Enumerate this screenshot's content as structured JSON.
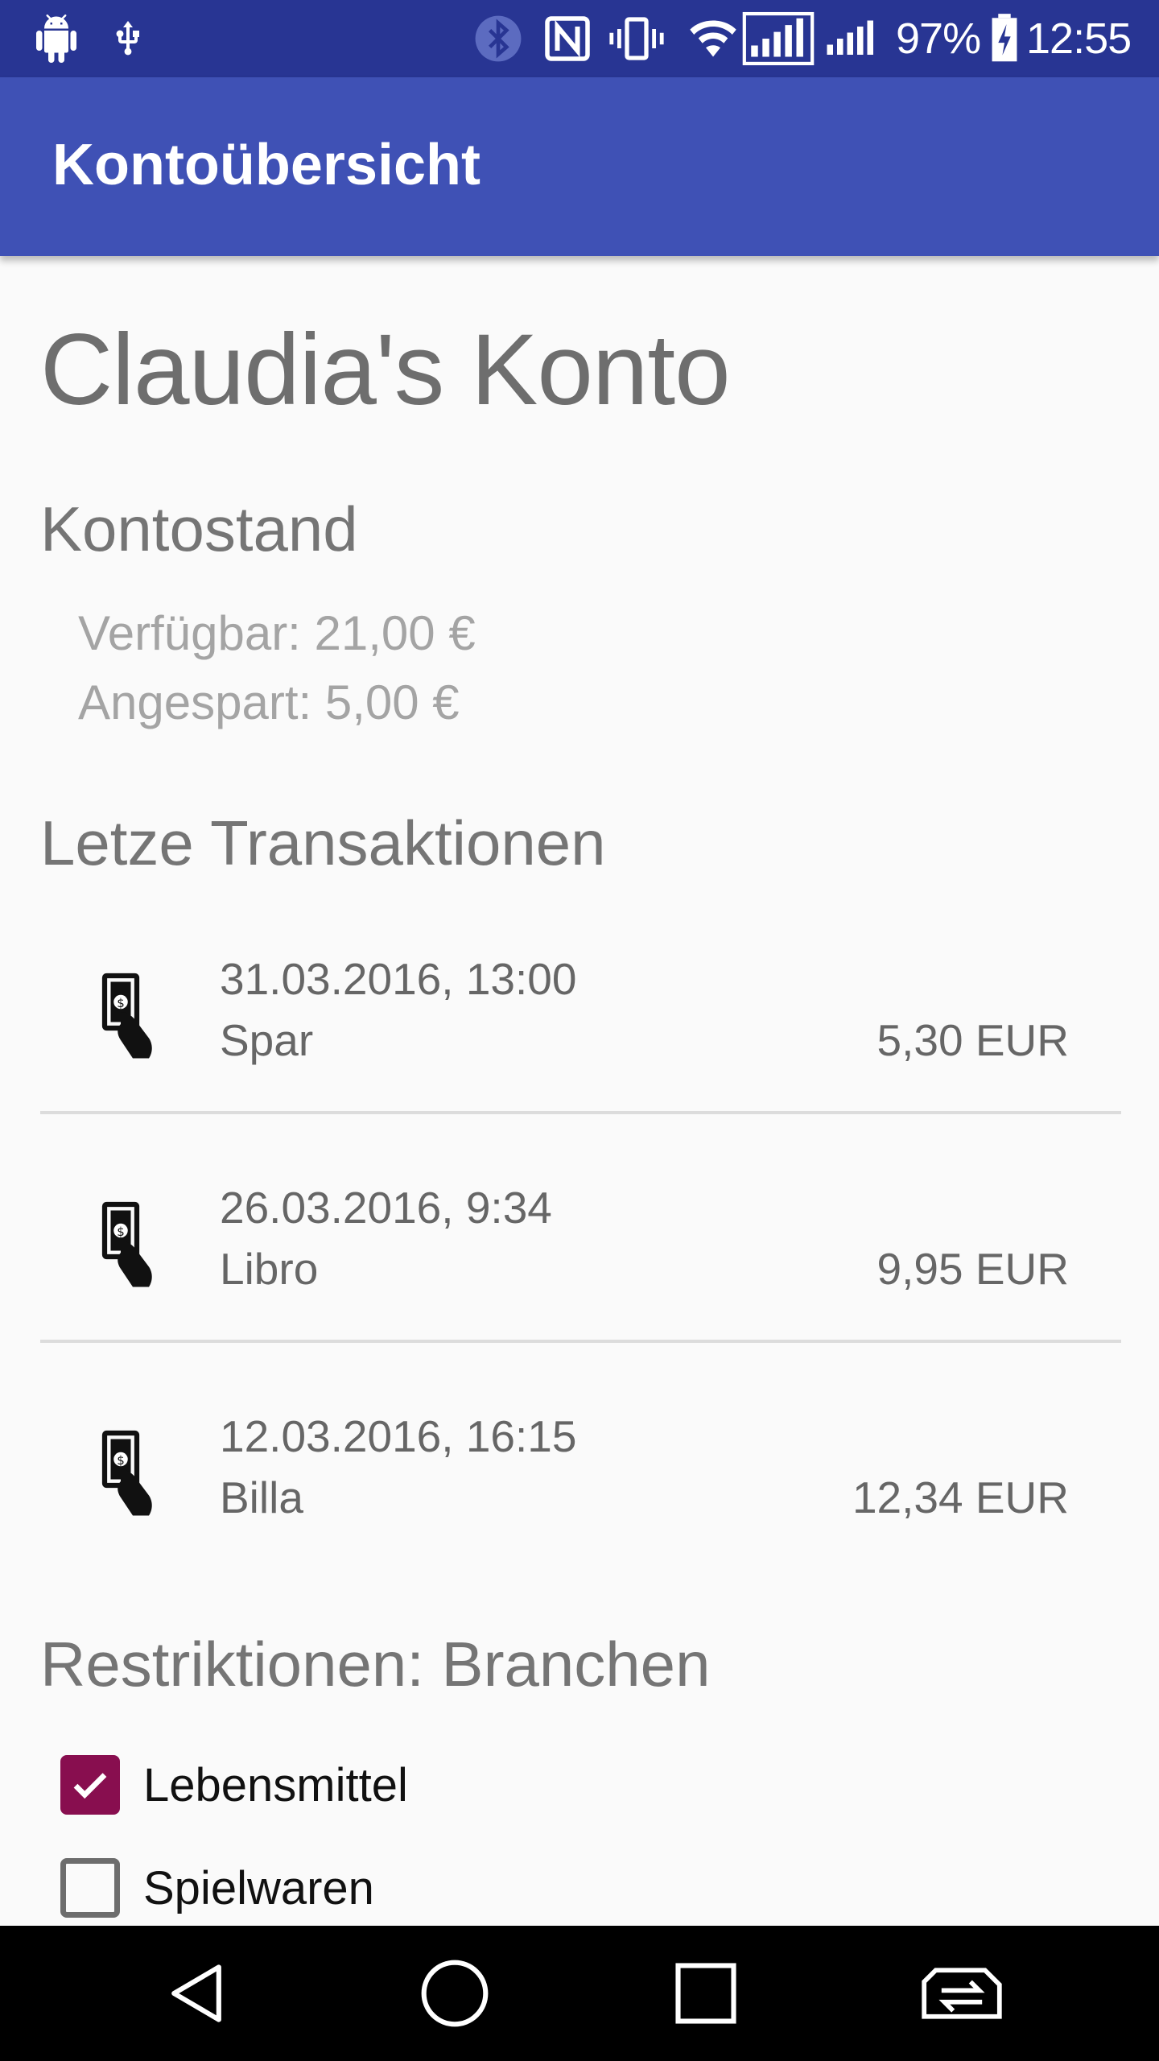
{
  "status_bar": {
    "battery_percent": "97%",
    "time": "12:55",
    "icons_left": [
      "android-debug-icon",
      "usb-icon"
    ],
    "icons_right": [
      "bluetooth-icon",
      "nfc-icon",
      "vibrate-icon",
      "wifi-icon",
      "signal-icon",
      "signal-icon",
      "battery-charging-icon"
    ]
  },
  "app_bar": {
    "title": "Kontoübersicht"
  },
  "account": {
    "title": "Claudia's Konto"
  },
  "balance": {
    "heading": "Kontostand",
    "available": "Verfügbar: 21,00 €",
    "saved": "Angespart: 5,00 €"
  },
  "transactions": {
    "heading": "Letze Transaktionen",
    "items": [
      {
        "date": "31.03.2016, 13:00",
        "merchant": "Spar",
        "amount": "5,30 EUR"
      },
      {
        "date": "26.03.2016, 9:34",
        "merchant": "Libro",
        "amount": "9,95 EUR"
      },
      {
        "date": "12.03.2016, 16:15",
        "merchant": "Billa",
        "amount": "12,34 EUR"
      }
    ]
  },
  "restrictions": {
    "heading": "Restriktionen: Branchen",
    "items": [
      {
        "label": "Lebensmittel",
        "checked": true
      },
      {
        "label": "Spielwaren",
        "checked": false
      }
    ]
  },
  "colors": {
    "status_bar": "#283593",
    "app_bar": "#3f51b5",
    "checkbox_checked": "#880e4f"
  }
}
